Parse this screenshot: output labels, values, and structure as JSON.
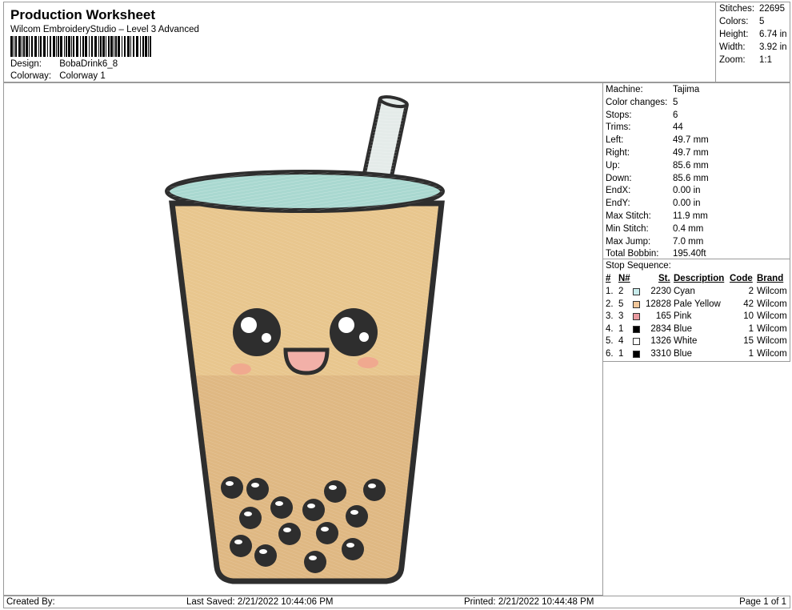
{
  "header": {
    "title": "Production Worksheet",
    "subtitle": "Wilcom EmbroideryStudio – Level 3 Advanced",
    "design_label": "Design:",
    "design_value": "BobaDrink6_8",
    "colorway_label": "Colorway:",
    "colorway_value": "Colorway 1"
  },
  "stats": [
    {
      "label": "Stitches:",
      "value": "22695"
    },
    {
      "label": "Colors:",
      "value": "5"
    },
    {
      "label": "Height:",
      "value": "6.74 in"
    },
    {
      "label": "Width:",
      "value": "3.92 in"
    },
    {
      "label": "Zoom:",
      "value": "1:1"
    }
  ],
  "machine": [
    {
      "label": "Machine:",
      "value": "Tajima"
    },
    {
      "label": "Color changes:",
      "value": "5"
    },
    {
      "label": "Stops:",
      "value": "6"
    },
    {
      "label": "Trims:",
      "value": "44"
    },
    {
      "label": "Left:",
      "value": "49.7 mm"
    },
    {
      "label": "Right:",
      "value": "49.7 mm"
    },
    {
      "label": "Up:",
      "value": "85.6 mm"
    },
    {
      "label": "Down:",
      "value": "85.6 mm"
    },
    {
      "label": "EndX:",
      "value": "0.00 in"
    },
    {
      "label": "EndY:",
      "value": "0.00 in"
    },
    {
      "label": "Max Stitch:",
      "value": "11.9 mm"
    },
    {
      "label": "Min Stitch:",
      "value": "0.4 mm"
    },
    {
      "label": "Max Jump:",
      "value": "7.0 mm"
    },
    {
      "label": "Total Bobbin:",
      "value": "195.40ft"
    }
  ],
  "stop_sequence": {
    "title": "Stop Sequence:",
    "headers": {
      "num": "#",
      "n": "N#",
      "st": "St.",
      "desc": "Description",
      "code": "Code",
      "brand": "Brand"
    },
    "rows": [
      {
        "num": "1.",
        "n": "2",
        "color": "#c8ecec",
        "st": "2230",
        "desc": "Cyan",
        "code": "2",
        "brand": "Wilcom"
      },
      {
        "num": "2.",
        "n": "5",
        "color": "#f2c79a",
        "st": "12828",
        "desc": "Pale Yellow",
        "code": "42",
        "brand": "Wilcom"
      },
      {
        "num": "3.",
        "n": "3",
        "color": "#e99aa0",
        "st": "165",
        "desc": "Pink",
        "code": "10",
        "brand": "Wilcom"
      },
      {
        "num": "4.",
        "n": "1",
        "color": "#000000",
        "st": "2834",
        "desc": "Blue",
        "code": "1",
        "brand": "Wilcom"
      },
      {
        "num": "5.",
        "n": "4",
        "color": "#ffffff",
        "st": "1326",
        "desc": "White",
        "code": "15",
        "brand": "Wilcom"
      },
      {
        "num": "6.",
        "n": "1",
        "color": "#000000",
        "st": "3310",
        "desc": "Blue",
        "code": "1",
        "brand": "Wilcom"
      }
    ]
  },
  "footer": {
    "created_by": "Created By:",
    "last_saved": "Last Saved: 2/21/2022 10:44:06 PM",
    "printed": "Printed: 2/21/2022 10:44:48 PM",
    "page": "Page 1 of 1"
  },
  "colors": {
    "lid": "#a9d8d0",
    "tea_top": "#e8c68e",
    "tea_bottom": "#dfb883",
    "outline": "#2e2e2e",
    "straw": "#e4ebe9",
    "blush": "#f0a98f",
    "mouth": "#f2b0a8"
  }
}
